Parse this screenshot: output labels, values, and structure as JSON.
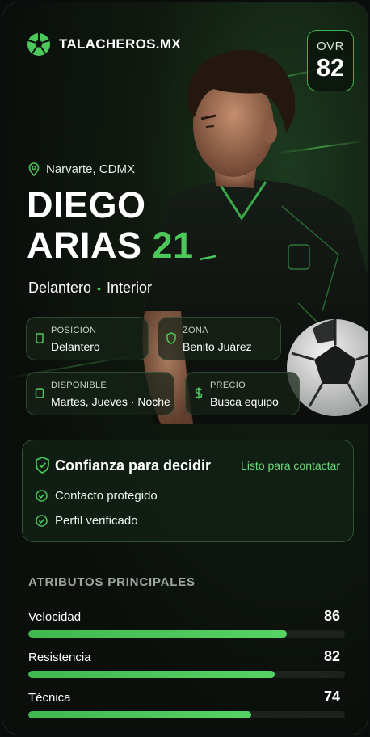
{
  "brand": {
    "name": "TALACHEROS.MX"
  },
  "ovr": {
    "label": "OVR",
    "value": "82"
  },
  "player": {
    "location": "Narvarte, CDMX",
    "first_name": "DIEGO",
    "last_name": "ARIAS",
    "number": "21",
    "position": "Delantero",
    "sub_position": "Interior"
  },
  "chips": [
    {
      "label": "POSICIÓN",
      "value": "Delantero",
      "icon": "shirt-icon"
    },
    {
      "label": "ZONA",
      "value": "Benito Juárez",
      "icon": "shield-icon"
    },
    {
      "label": "DISPONIBLE",
      "value": "Martes, Jueves · Noche",
      "icon": "calendar-icon"
    },
    {
      "label": "PRECIO",
      "value": "Busca equipo",
      "icon": "dollar-icon"
    }
  ],
  "trust": {
    "title": "Confianza para decidir",
    "status": "Listo para contactar",
    "items": [
      "Contacto protegido",
      "Perfil verificado"
    ]
  },
  "attributes": {
    "title": "ATRIBUTOS PRINCIPALES",
    "items": [
      {
        "name": "Velocidad",
        "value": 86
      },
      {
        "name": "Resistencia",
        "value": 82
      },
      {
        "name": "Técnica",
        "value": 74
      }
    ]
  },
  "colors": {
    "accent": "#4cc95a",
    "background": "#0b0f0c",
    "track": "#1d221e"
  }
}
